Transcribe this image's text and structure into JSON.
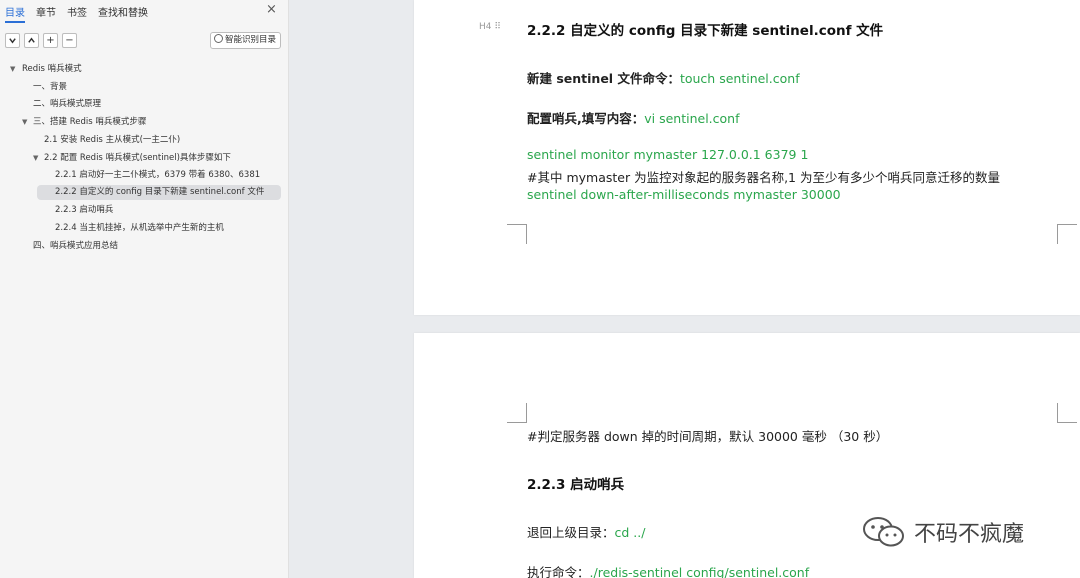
{
  "sidebar": {
    "tabs": [
      "目录",
      "章节",
      "书签",
      "查找和替换"
    ],
    "close_icon": "×",
    "toolbar": {
      "collapse_icon": "chevron-down",
      "expand_icon": "chevron-up",
      "add_icon": "+",
      "remove_icon": "−",
      "smart_toc_label": "智能识别目录"
    },
    "toc": [
      {
        "label": "Redis 哨兵模式",
        "level": 0,
        "caret": "▼"
      },
      {
        "label": "一、背景",
        "level": 1,
        "caret": ""
      },
      {
        "label": "二、哨兵模式原理",
        "level": 1,
        "caret": ""
      },
      {
        "label": "三、搭建 Redis 哨兵模式步骤",
        "level": 1,
        "caret": "▼"
      },
      {
        "label": "2.1  安装 Redis 主从模式(一主二仆)",
        "level": 2,
        "caret": ""
      },
      {
        "label": "2.2  配置 Redis 哨兵模式(sentinel)具体步骤如下",
        "level": 2,
        "caret": "▼"
      },
      {
        "label": "2.2.1  启动好一主二仆模式，6379 带着 6380、6381",
        "level": 3,
        "caret": ""
      },
      {
        "label": "2.2.2  自定义的 config 目录下新建 sentinel.conf 文件",
        "level": 3,
        "caret": "",
        "selected": true
      },
      {
        "label": "2.2.3  启动哨兵",
        "level": 3,
        "caret": ""
      },
      {
        "label": "2.2.4  当主机挂掉，从机选举中产生新的主机",
        "level": 3,
        "caret": ""
      },
      {
        "label": "四、哨兵模式应用总结",
        "level": 1,
        "caret": ""
      }
    ]
  },
  "document": {
    "heading_marker": "H4 ⠿",
    "heading_222": "2.2.2  自定义的 config 目录下新建 sentinel.conf 文件",
    "new_file_label": "新建 sentinel 文件命令：",
    "new_file_cmd": "touch sentinel.conf",
    "config_label": "配置哨兵,填写内容：",
    "config_cmd": "vi sentinel.conf",
    "line_monitor": "sentinel monitor mymaster 127.0.0.1 6379 1",
    "line_comment1": "#其中 mymaster 为监控对象起的服务器名称,1 为至少有多少个哨兵同意迁移的数量",
    "line_down_after": "sentinel down-after-milliseconds mymaster 30000",
    "line_comment2": "#判定服务器 down 掉的时间周期，默认 30000 毫秒 （30 秒）",
    "heading_223": "2.2.3  启动哨兵",
    "back_dir_label": "退回上级目录：",
    "back_dir_cmd": "cd ../",
    "exec_label": "执行命令：",
    "exec_cmd": "./redis-sentinel config/sentinel.conf"
  },
  "watermark": {
    "text": "不码不疯魔",
    "logo_icon": "wechat-logo"
  },
  "colors": {
    "accent": "#2b6fd6",
    "code_green": "#2aa64c",
    "selected_bg": "#dcdde0"
  }
}
